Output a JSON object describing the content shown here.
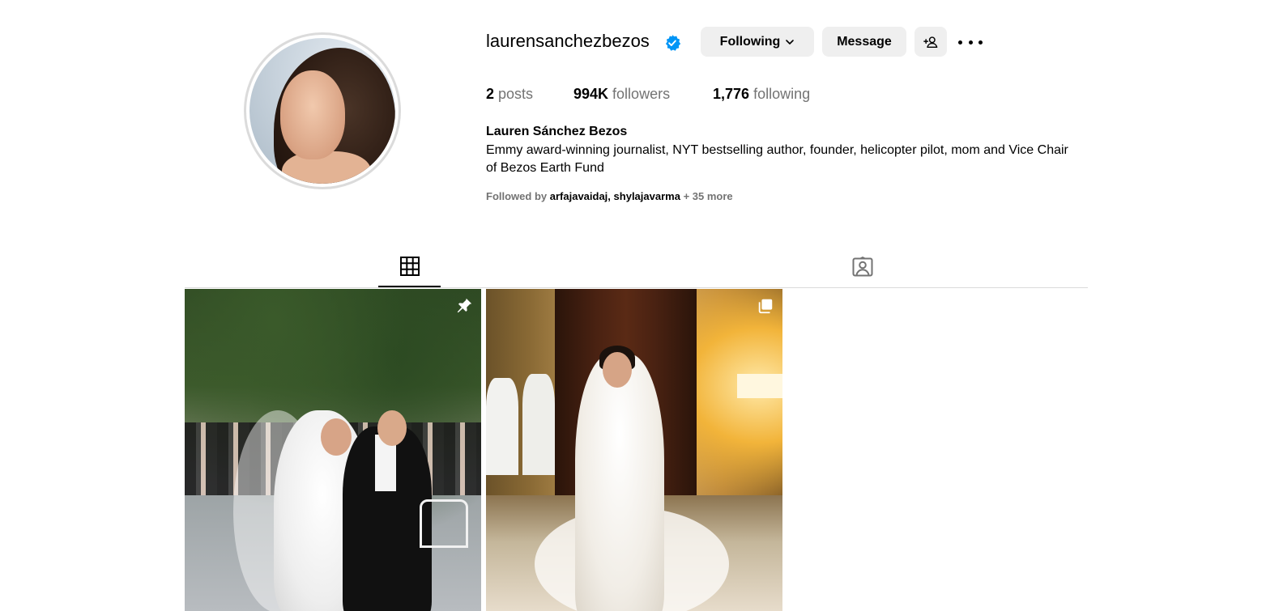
{
  "profile": {
    "username": "laurensanchezbezos",
    "full_name": "Lauren Sánchez Bezos",
    "bio": "Emmy award-winning journalist, NYT bestselling author, founder, helicopter pilot, mom and Vice Chair of Bezos Earth Fund",
    "verified": true
  },
  "actions": {
    "following_label": "Following",
    "message_label": "Message"
  },
  "stats": {
    "posts_count": "2",
    "posts_label": "posts",
    "followers_count": "994K",
    "followers_label": "followers",
    "following_count": "1,776",
    "following_label": "following"
  },
  "followed_by": {
    "prefix": "Followed by",
    "accounts": [
      "arfajavaidaj",
      "shylajavarma"
    ],
    "separator": ",",
    "more": "+ 35 more"
  },
  "tabs": [
    {
      "icon": "grid-icon",
      "active": true
    },
    {
      "icon": "tagged-icon",
      "active": false
    }
  ],
  "posts": [
    {
      "badge_icon": "pin-icon"
    },
    {
      "badge_icon": "multi-image-icon"
    }
  ],
  "colors": {
    "verified_blue": "#0095f6",
    "button_bg": "#efefef",
    "secondary_text": "#737373",
    "divider": "#dbdbdb"
  }
}
